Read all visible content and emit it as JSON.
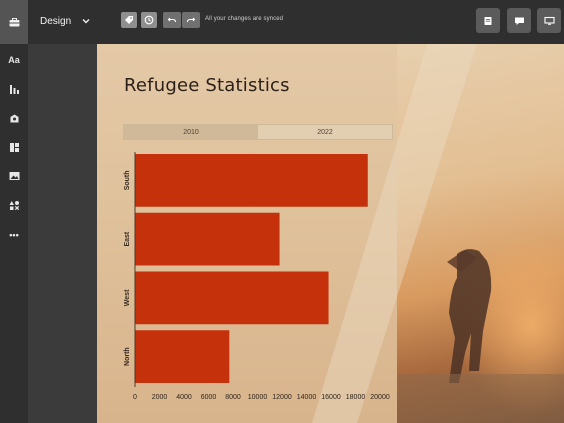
{
  "topbar": {
    "design_label": "Design",
    "sync_status": "All your changes are synced"
  },
  "icons": {
    "home": "briefcase-icon",
    "chevron": "chevron-down-icon",
    "tag": "tag-icon",
    "history": "clock-icon",
    "undo": "undo-icon",
    "redo": "redo-icon",
    "notes": "notes-icon",
    "comment": "comment-icon",
    "present": "monitor-icon"
  },
  "sidebar": {
    "items": [
      {
        "name": "text",
        "label": "Aa"
      },
      {
        "name": "charts"
      },
      {
        "name": "media"
      },
      {
        "name": "layouts"
      },
      {
        "name": "images"
      },
      {
        "name": "shapes"
      },
      {
        "name": "more",
        "label": "•••"
      }
    ]
  },
  "slide": {
    "title": "Refugee Statistics",
    "tabs": [
      {
        "label": "2010",
        "active": true
      },
      {
        "label": "2022",
        "active": false
      }
    ]
  },
  "colors": {
    "bar": "#c4310a",
    "axis": "#4a3a2c",
    "toolbar_bg": "#2f2f2f"
  },
  "chart_data": {
    "type": "bar",
    "orientation": "horizontal",
    "categories": [
      "South",
      "East",
      "West",
      "North"
    ],
    "values": [
      19000,
      11800,
      15800,
      7700
    ],
    "xlim": [
      0,
      20000
    ],
    "xticks": [
      "0",
      "2000",
      "4000",
      "6000",
      "8000",
      "10000",
      "12000",
      "14000",
      "16000",
      "18000",
      "20000"
    ],
    "title": "",
    "xlabel": "",
    "ylabel": "",
    "grid": false
  }
}
